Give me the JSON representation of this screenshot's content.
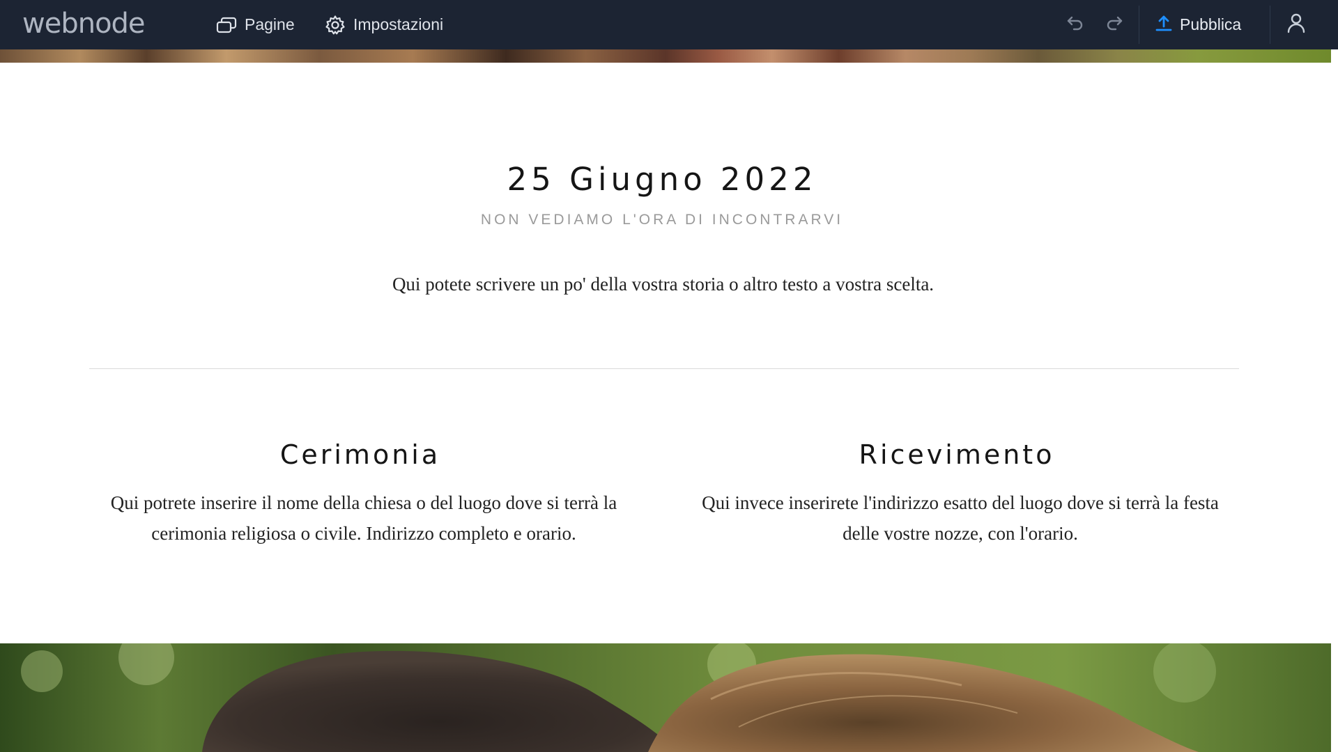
{
  "toolbar": {
    "logo": "webnode",
    "pages_label": "Pagine",
    "pages_icon": "pages-icon",
    "settings_label": "Impostazioni",
    "settings_icon": "gear-icon",
    "undo_icon": "undo-icon",
    "redo_icon": "redo-icon",
    "publish_label": "Pubblica",
    "publish_icon": "upload-icon",
    "account_icon": "user-icon",
    "colors": {
      "background": "#1c2433",
      "publish_accent": "#1e8fff"
    }
  },
  "page": {
    "date_title": "25 Giugno 2022",
    "subtitle": "NON VEDIAMO L'ORA DI INCONTRARVI",
    "intro": "Qui potete scrivere un po' della vostra storia o altro testo a vostra scelta.",
    "columns": [
      {
        "title": "Cerimonia",
        "text": "Qui potrete inserire il nome della chiesa o del luogo dove si terrà la cerimonia religiosa o civile. Indirizzo completo e orario."
      },
      {
        "title": "Ricevimento",
        "text": "Qui invece inserirete l'indirizzo esatto del luogo dove si terrà la festa delle vostre nozze, con l'orario."
      }
    ]
  }
}
